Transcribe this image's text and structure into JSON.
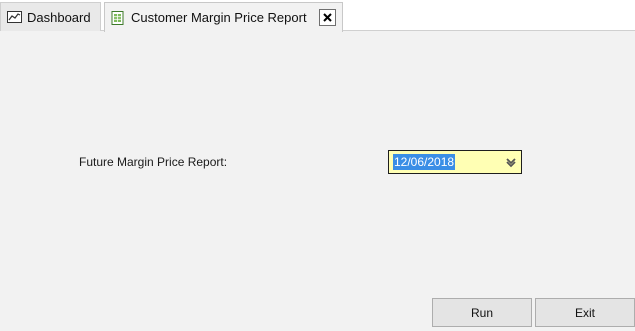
{
  "tabs": [
    {
      "label": "Dashboard",
      "icon": "chart-icon",
      "active": false
    },
    {
      "label": "Customer Margin Price Report",
      "icon": "spreadsheet-icon",
      "active": true
    }
  ],
  "form": {
    "future_margin_label": "Future Margin Price Report:",
    "date_value": "12/06/2018"
  },
  "buttons": {
    "run_label": "Run",
    "exit_label": "Exit"
  },
  "colors": {
    "date_field_bg": "#ffffb4",
    "selection": "#3a8ee6"
  }
}
